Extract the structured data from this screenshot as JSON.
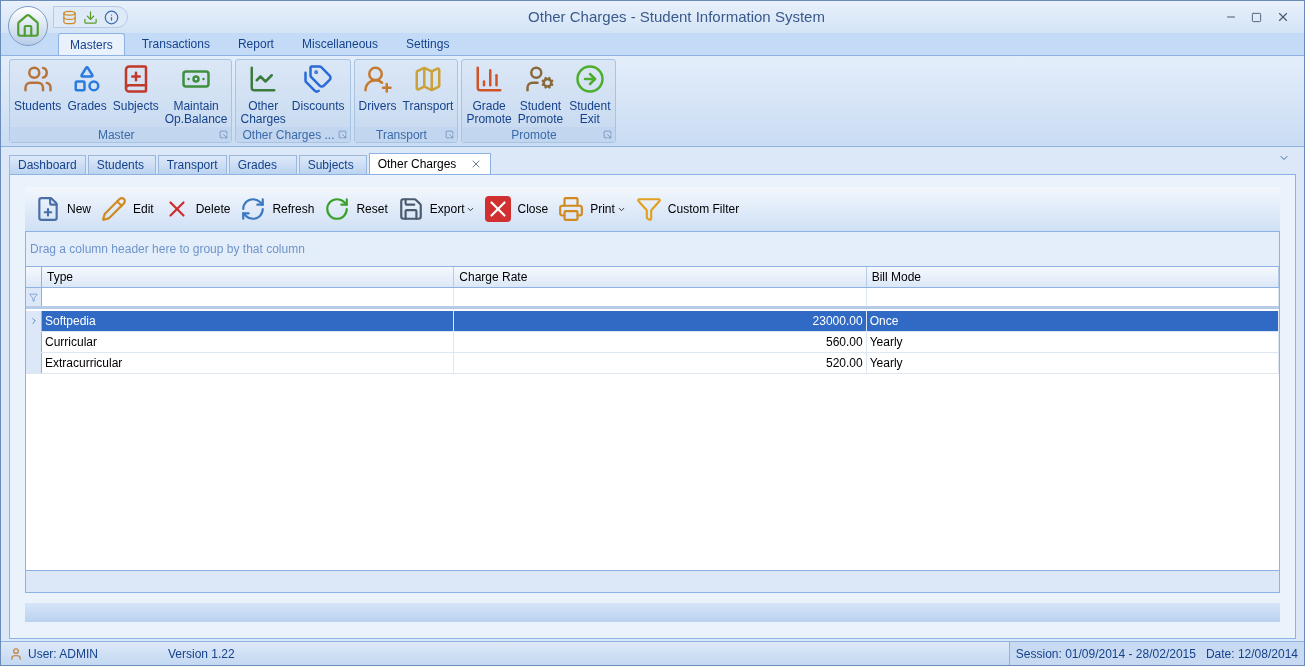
{
  "window": {
    "title": "Other Charges - Student Information System"
  },
  "ribbon": {
    "tabs": [
      {
        "label": "Masters",
        "selected": true
      },
      {
        "label": "Transactions",
        "selected": false
      },
      {
        "label": "Report",
        "selected": false
      },
      {
        "label": "Miscellaneous",
        "selected": false
      },
      {
        "label": "Settings",
        "selected": false
      }
    ],
    "groups": [
      {
        "caption": "Master",
        "items": [
          "Students",
          "Grades",
          "Subjects",
          "Maintain\nOp.Balance"
        ]
      },
      {
        "caption": "Other Charges ...",
        "items": [
          "Other\nCharges",
          "Discounts"
        ]
      },
      {
        "caption": "Transport",
        "items": [
          "Drivers",
          "Transport"
        ]
      },
      {
        "caption": "Promote",
        "items": [
          "Grade\nPromote",
          "Student\nPromote",
          "Student\nExit"
        ]
      }
    ]
  },
  "document_tabs": [
    {
      "label": "Dashboard",
      "selected": false,
      "closable": false
    },
    {
      "label": "Students",
      "selected": false,
      "closable": false
    },
    {
      "label": "Transport",
      "selected": false,
      "closable": false
    },
    {
      "label": "Grades",
      "selected": false,
      "closable": false
    },
    {
      "label": "Subjects",
      "selected": false,
      "closable": false
    },
    {
      "label": "Other Charges",
      "selected": true,
      "closable": true
    }
  ],
  "toolbar": [
    {
      "label": "New",
      "kind": "button"
    },
    {
      "label": "Edit",
      "kind": "button"
    },
    {
      "label": "Delete",
      "kind": "button"
    },
    {
      "label": "Refresh",
      "kind": "button"
    },
    {
      "label": "Reset",
      "kind": "button"
    },
    {
      "label": "Export",
      "kind": "dropdown"
    },
    {
      "label": "Close",
      "kind": "button"
    },
    {
      "label": "Print",
      "kind": "dropdown"
    },
    {
      "label": "Custom Filter",
      "kind": "button"
    }
  ],
  "grid": {
    "group_hint": "Drag a column header here to group by that column",
    "columns": [
      "Type",
      "Charge Rate",
      "Bill Mode"
    ],
    "rows": [
      {
        "selected": true,
        "cells": [
          "Softpedia",
          "23000.00",
          "Once"
        ]
      },
      {
        "selected": false,
        "cells": [
          "Curricular",
          "560.00",
          "Yearly"
        ]
      },
      {
        "selected": false,
        "cells": [
          "Extracurricular",
          "520.00",
          "Yearly"
        ]
      }
    ]
  },
  "status_bar": {
    "user": "User:  ADMIN",
    "version": "Version 1.22",
    "session": "Session:  01/09/2014 - 28/02/2015",
    "date": "Date:  12/08/2014"
  }
}
